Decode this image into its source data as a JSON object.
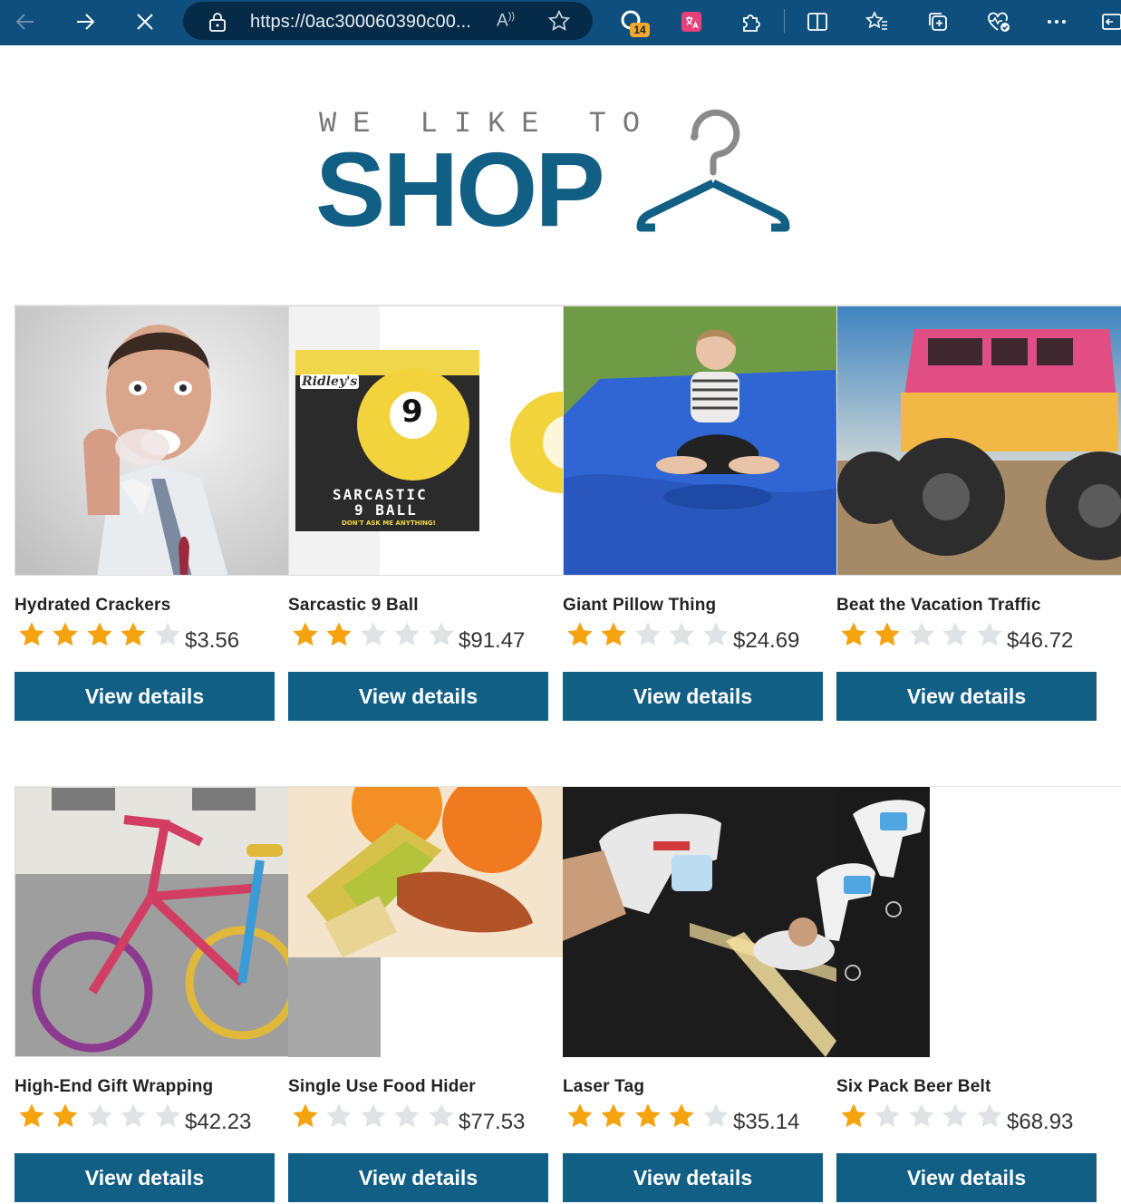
{
  "browser": {
    "url": "https://0ac300060390c00...",
    "extensions_badge": "14",
    "read_aloud_label": "A⁾"
  },
  "logo": {
    "tagline": "WE LIKE TO",
    "word": "SHOP"
  },
  "products": [
    {
      "name": "Hydrated Crackers",
      "rating": 4,
      "max_rating": 5,
      "price": "$3.56",
      "button": "View details"
    },
    {
      "name": "Sarcastic 9 Ball",
      "rating": 2,
      "max_rating": 5,
      "price": "$91.47",
      "button": "View details",
      "box_text": {
        "brand": "Ridley's",
        "line1": "SARCASTIC",
        "line2": "9 BALL",
        "sub": "DON'T ASK ME ANYTHING!",
        "n": "9"
      }
    },
    {
      "name": "Giant Pillow Thing",
      "rating": 2,
      "max_rating": 5,
      "price": "$24.69",
      "button": "View details"
    },
    {
      "name": "Beat the Vacation Traffic",
      "rating": 2,
      "max_rating": 5,
      "price": "$46.72",
      "button": "View details"
    },
    {
      "name": "High-End Gift Wrapping",
      "rating": 2,
      "max_rating": 5,
      "price": "$42.23",
      "button": "View details"
    },
    {
      "name": "Single Use Food Hider",
      "rating": 1,
      "max_rating": 5,
      "price": "$77.53",
      "button": "View details"
    },
    {
      "name": "Laser Tag",
      "rating": 4,
      "max_rating": 5,
      "price": "$35.14",
      "button": "View details"
    },
    {
      "name": "Six Pack Beer Belt",
      "rating": 1,
      "max_rating": 5,
      "price": "$68.93",
      "button": "View details"
    }
  ],
  "colors": {
    "chrome": "#0f4f7d",
    "brand": "#125f86",
    "star_on": "#f5a30f",
    "star_off": "#dfe3e6"
  },
  "icons": {
    "back": "arrow-left-icon",
    "forward": "arrow-right-icon",
    "stop": "close-icon",
    "lock": "lock-icon",
    "favorite": "star-icon",
    "hanger": "hanger-icon"
  }
}
